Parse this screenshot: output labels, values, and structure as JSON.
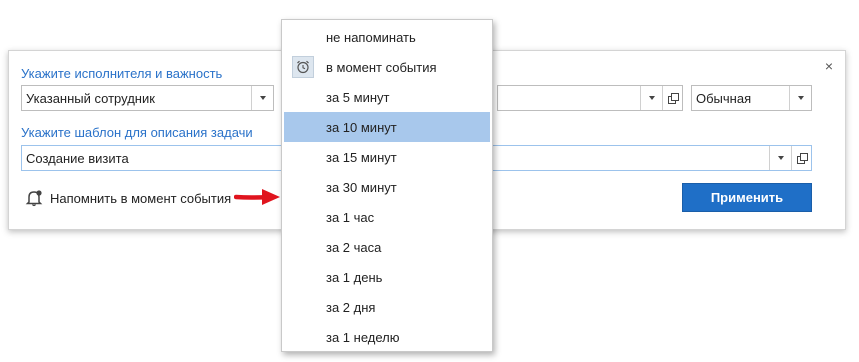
{
  "dialog": {
    "close_label": "×",
    "executor_label": "Укажите исполнителя и важность",
    "executor_value": "Указанный сотрудник",
    "importance_value": "Обычная",
    "template_label": "Укажите шаблон для описания задачи",
    "template_value": "Создание визита",
    "reminder_text": "Напомнить в момент события",
    "apply_label": "Применить"
  },
  "menu": {
    "items": [
      {
        "label": "не напоминать"
      },
      {
        "label": "в момент события",
        "icon": "alarm-clock-icon"
      },
      {
        "label": "за 5 минут"
      },
      {
        "label": "за 10 минут",
        "selected": true
      },
      {
        "label": "за 15 минут"
      },
      {
        "label": "за 30 минут"
      },
      {
        "label": "за 1 час"
      },
      {
        "label": "за 2 часа"
      },
      {
        "label": "за 1 день"
      },
      {
        "label": "за 2 дня"
      },
      {
        "label": "за 1 неделю"
      }
    ]
  },
  "colors": {
    "accent": "#1f6fc7",
    "label_blue": "#2a72c9",
    "selected_item": "#a8c8ec",
    "arrow": "#e0141e"
  }
}
